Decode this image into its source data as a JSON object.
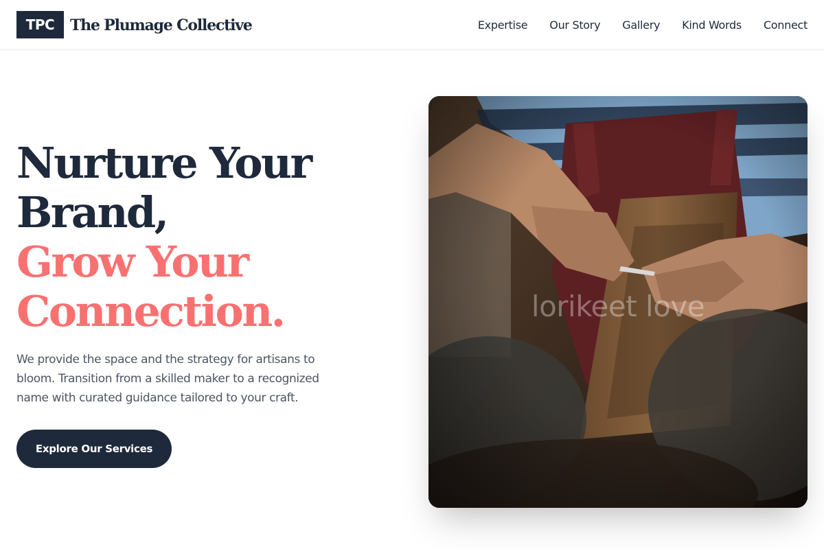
{
  "header": {
    "logo_badge": "TPC",
    "brand_name": "The Plumage Collective",
    "nav": [
      {
        "label": "Expertise"
      },
      {
        "label": "Our Story"
      },
      {
        "label": "Gallery"
      },
      {
        "label": "Kind Words"
      },
      {
        "label": "Connect"
      }
    ]
  },
  "hero": {
    "headline_line1": "Nurture Your",
    "headline_line2": "Brand,",
    "headline_line3": "Grow Your",
    "headline_line4": "Connection.",
    "subtext": "We provide the space and the strategy for artisans to bloom. Transition from a skilled maker to a recognized name with curated guidance tailored to your craft.",
    "cta_label": "Explore Our Services",
    "image_watermark": "lorikeet love"
  },
  "colors": {
    "primary": "#1e293b",
    "accent": "#f87171",
    "body_text": "#4b5563"
  }
}
